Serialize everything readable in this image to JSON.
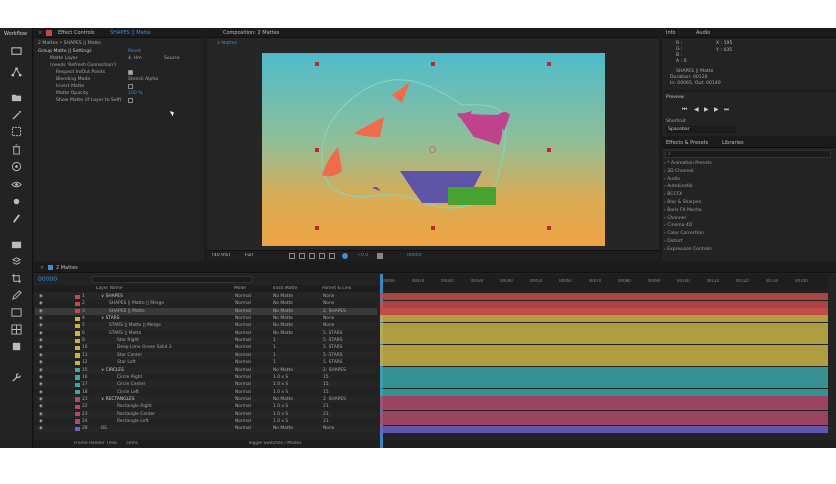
{
  "menu_title": "Workflow",
  "effect_controls": {
    "tab_label": "Effect Controls",
    "tab_context": "SHAPES || Matte",
    "breadcrumb": "2 Mattes • SHAPES || Matte",
    "effect_name": "Group Matte || Settings",
    "reset_label": "Reset",
    "matte_layer_label": "Matte Layer",
    "matte_layer_value": "4. Hm",
    "matte_source": "Source",
    "needs_refresh": "(needs 'Refresh Connection')",
    "respect_pivots": "Respect In/Out Points",
    "blending_mode_label": "Blending Mode",
    "blending_mode_value": "Stencil Alpha",
    "invert_matte": "Invert Matte",
    "matte_opacity_label": "Matte Opacity",
    "matte_opacity_value": "100 %",
    "show_matte": "Show Matte (if Layer to Self)"
  },
  "composition": {
    "tab_label": "Composition: 2 Mattes",
    "sub_tab": "2 Mattes",
    "zoom": "(40.9%)",
    "resolution": "Full",
    "timecode": "00000",
    "exposure": "+0.0"
  },
  "info_panel": {
    "tab_info": "Info",
    "tab_audio": "Audio",
    "x_label": "X : 195",
    "y_label": "Y : 435",
    "layer_name": "SHAPES || Matte",
    "duration": "Duration: 00120",
    "in_out": "In: 00065, Out: 00149"
  },
  "preview_panel": {
    "title": "Preview",
    "shortcut_label": "Shortcut",
    "shortcut_value": "Spacebar"
  },
  "effects_presets": {
    "tab_label": "Effects & Presets",
    "tab_libraries": "Libraries",
    "items": [
      "* Animation Presets",
      "3D Channel",
      "Audio",
      "Autokinetik",
      "BCCFX",
      "Blur & Sharpen",
      "Boris FX Mocha",
      "Channel",
      "Cinema 4D",
      "Color Correction",
      "Distort",
      "Expression Controls"
    ]
  },
  "timeline": {
    "tab_label": "2 Mattes",
    "timecode": "00000",
    "col_layer_name": "Layer Name",
    "col_mode": "Mode",
    "col_trkmat": "Track Matte",
    "col_parent": "Parent & Link",
    "footer_render": "Frame Render Time",
    "footer_render_value": "50ms",
    "footer_toggle": "Toggle Switches / Modes",
    "ruler": [
      "00000",
      "00010",
      "00020",
      "00030",
      "00040",
      "00050",
      "00060",
      "00070",
      "00080",
      "00090",
      "00100",
      "00110",
      "00120",
      "00130",
      "00140"
    ],
    "layers": [
      {
        "num": "1",
        "name": "SHAPES",
        "indent": 0,
        "color": "#c44a4a",
        "mode": "Normal",
        "trk": "No Matte",
        "parent": "None",
        "group": true
      },
      {
        "num": "2",
        "name": "SHAPES || Matte || Merge",
        "indent": 1,
        "color": "#c44a4a",
        "mode": "Normal",
        "trk": "No Matte",
        "parent": "None",
        "group": false
      },
      {
        "num": "3",
        "name": "SHAPES || Matte",
        "indent": 1,
        "color": "#c44a4a",
        "mode": "Normal",
        "trk": "No Matte",
        "parent": "2. SHAPES",
        "group": false,
        "selected": true
      },
      {
        "num": "4",
        "name": "STARS",
        "indent": 0,
        "color": "#c9b246",
        "mode": "Normal",
        "trk": "No Matte",
        "parent": "None",
        "group": true
      },
      {
        "num": "5",
        "name": "STARS || Matte || Merge",
        "indent": 1,
        "color": "#c9b246",
        "mode": "Normal",
        "trk": "No Matte",
        "parent": "None",
        "group": false
      },
      {
        "num": "6",
        "name": "STARS || Matte",
        "indent": 1,
        "color": "#c9b246",
        "mode": "Normal",
        "trk": "No Matte",
        "parent": "5. STARS",
        "group": false
      },
      {
        "num": "8",
        "name": "Star Right",
        "indent": 2,
        "color": "#c9b246",
        "mode": "Normal",
        "trk": "1",
        "parent": "5. STARS",
        "group": false
      },
      {
        "num": "10",
        "name": "Deep Lime Green Solid 3",
        "indent": 2,
        "color": "#c9b246",
        "mode": "Normal",
        "trk": "1",
        "parent": "5. STARS",
        "group": false
      },
      {
        "num": "11",
        "name": "Star Center",
        "indent": 2,
        "color": "#c9b246",
        "mode": "Normal",
        "trk": "1",
        "parent": "5. STARS",
        "group": false
      },
      {
        "num": "12",
        "name": "Star Left",
        "indent": 2,
        "color": "#c9b246",
        "mode": "Normal",
        "trk": "1",
        "parent": "5. STARS",
        "group": false
      },
      {
        "num": "15",
        "name": "CIRCLES",
        "indent": 0,
        "color": "#3aa6a6",
        "mode": "Normal",
        "trk": "No Matte",
        "parent": "2. SHAPES",
        "group": true
      },
      {
        "num": "16",
        "name": "Circle Right",
        "indent": 2,
        "color": "#3aa6a6",
        "mode": "Normal",
        "trk": "1.0 x S",
        "parent": "15.",
        "group": false
      },
      {
        "num": "17",
        "name": "Circle Center",
        "indent": 2,
        "color": "#3aa6a6",
        "mode": "Normal",
        "trk": "1.0 x S",
        "parent": "15.",
        "group": false
      },
      {
        "num": "18",
        "name": "Circle Left",
        "indent": 2,
        "color": "#3aa6a6",
        "mode": "Normal",
        "trk": "1.0 x S",
        "parent": "15.",
        "group": false
      },
      {
        "num": "21",
        "name": "RECTANGLES",
        "indent": 0,
        "color": "#b04a6a",
        "mode": "Normal",
        "trk": "No Matte",
        "parent": "2. SHAPES",
        "group": true
      },
      {
        "num": "22",
        "name": "Rectangle Right",
        "indent": 2,
        "color": "#b04a6a",
        "mode": "Normal",
        "trk": "1.0 x S",
        "parent": "21.",
        "group": false
      },
      {
        "num": "23",
        "name": "Rectangle Center",
        "indent": 2,
        "color": "#b04a6a",
        "mode": "Normal",
        "trk": "1.0 x S",
        "parent": "21.",
        "group": false
      },
      {
        "num": "24",
        "name": "Rectangle Left",
        "indent": 2,
        "color": "#b04a6a",
        "mode": "Normal",
        "trk": "1.0 x S",
        "parent": "21.",
        "group": false
      },
      {
        "num": "28",
        "name": "BG",
        "indent": 0,
        "color": "#6a62c4",
        "mode": "Normal",
        "trk": "No Matte",
        "parent": "None",
        "group": false
      }
    ]
  }
}
